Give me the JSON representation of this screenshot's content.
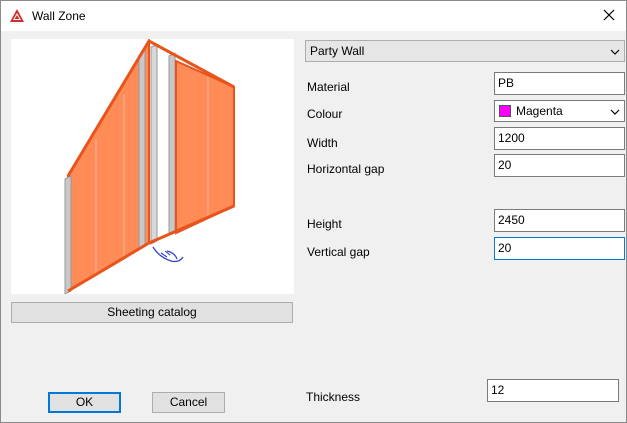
{
  "window": {
    "title": "Wall Zone",
    "app_icon": "autocad-icon",
    "close_icon": "close-icon"
  },
  "wall_type": {
    "selected": "Party Wall"
  },
  "fields": {
    "material": {
      "label": "Material",
      "value": "PB"
    },
    "colour": {
      "label": "Colour",
      "value": "Magenta",
      "swatch_color": "#ff00ff"
    },
    "width": {
      "label": "Width",
      "value": "1200"
    },
    "horizontal_gap": {
      "label": "Horizontal gap",
      "value": "20"
    },
    "height": {
      "label": "Height",
      "value": "2450"
    },
    "vertical_gap": {
      "label": "Vertical gap",
      "value": "20"
    },
    "thickness": {
      "label": "Thickness",
      "value": "12"
    }
  },
  "buttons": {
    "sheeting_catalog": "Sheeting catalog",
    "ok": "OK",
    "cancel": "Cancel"
  },
  "colors": {
    "accent": "#0078d7",
    "sheet_orange": "#ff8b57",
    "sheet_edge": "#e8541c",
    "stud_grey": "#c8c8c8"
  }
}
